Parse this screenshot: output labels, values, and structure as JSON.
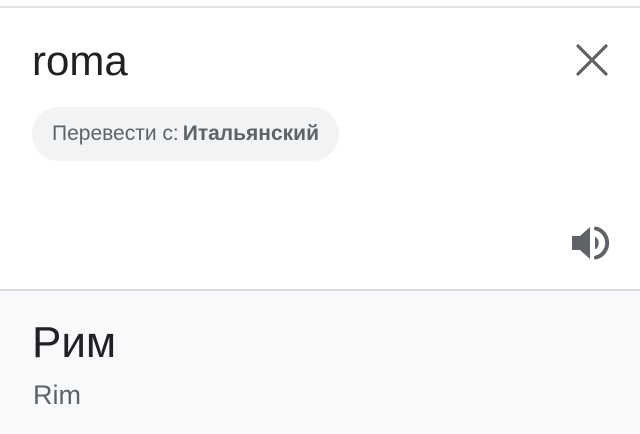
{
  "source": {
    "text": "roma",
    "clear_icon": "close-icon",
    "speaker_icon": "volume-up-icon"
  },
  "language_chip": {
    "prefix": "Перевести с:",
    "language": "Итальянский"
  },
  "result": {
    "translation": "Рим",
    "transliteration": "Rim"
  },
  "colors": {
    "text_primary": "#202124",
    "text_secondary": "#5f6368",
    "chip_background": "#f1f3f4",
    "result_background": "#f8f9fa",
    "divider": "#dadce0"
  }
}
